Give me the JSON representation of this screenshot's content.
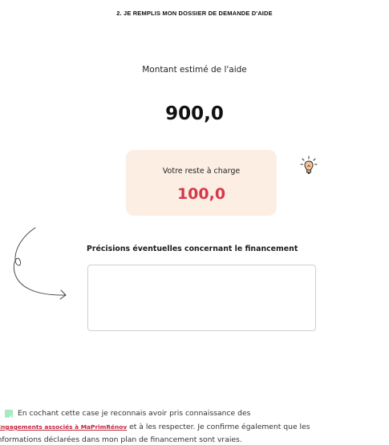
{
  "step_title": "2. JE REMPLIS MON DOSSIER DE DEMANDE D'AIDE",
  "amount": {
    "label": "Montant estimé de l'aide",
    "value": "900,0"
  },
  "remaining": {
    "label": "Votre reste à charge",
    "value": "100,0",
    "accent_color": "#d6384b",
    "card_color": "#fdeee4"
  },
  "icons": {
    "bulb": "lightbulb-icon",
    "arrow": "curved-arrow-icon",
    "checkbox": "checkmark-icon"
  },
  "precisions": {
    "label": "Précisions éventuelles concernant le financement",
    "value": "",
    "placeholder": ""
  },
  "consent": {
    "line1": "En cochant cette case je reconnais avoir pris connaissance des",
    "link_label": "Engagements associés à MaPrimRénov",
    "line2_after": " et à les respecter. Je confirme également que les",
    "line3": "informations déclarées dans mon plan de financement sont vraies.",
    "checked": true,
    "checkbox_color": "#a9e8c2"
  }
}
